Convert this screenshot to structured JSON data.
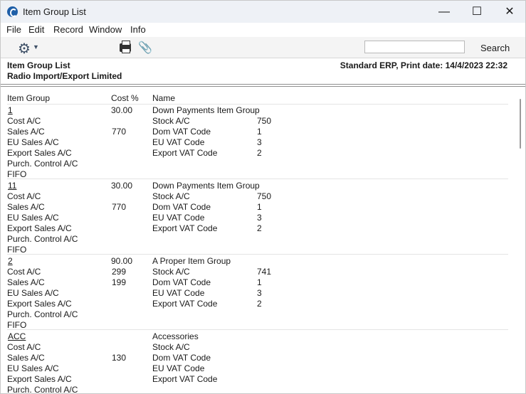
{
  "window": {
    "title": "Item Group List",
    "minimize_icon": "minimize-icon",
    "maximize_icon": "maximize-icon",
    "close_icon": "close-icon"
  },
  "menu": [
    "File",
    "Edit",
    "Record",
    "Window",
    "Info"
  ],
  "toolbar": {
    "search_value": "",
    "search_label": "Search"
  },
  "report": {
    "title": "Item Group List",
    "company": "Radio Import/Export Limited",
    "meta": "Standard ERP, Print date: 14/4/2023 22:32"
  },
  "columns": {
    "group": "Item Group",
    "cost": "Cost %",
    "name": "Name"
  },
  "groups": [
    {
      "code": "1",
      "cost": "30.00",
      "name": "Down Payments Item Group",
      "left": [
        "Cost A/C",
        "Sales A/C",
        "EU Sales A/C",
        "Export Sales A/C",
        "Purch. Control A/C",
        "FIFO"
      ],
      "left_vals": [
        "",
        "770",
        "",
        "",
        "",
        ""
      ],
      "right": [
        "Stock A/C",
        "Dom VAT Code",
        "EU VAT Code",
        "Export VAT Code"
      ],
      "right_vals": [
        "750",
        "1",
        "3",
        "2"
      ]
    },
    {
      "code": "11",
      "cost": "30.00",
      "name": "Down Payments Item Group",
      "left": [
        "Cost A/C",
        "Sales A/C",
        "EU Sales A/C",
        "Export Sales A/C",
        "Purch. Control A/C",
        "FIFO"
      ],
      "left_vals": [
        "",
        "770",
        "",
        "",
        "",
        ""
      ],
      "right": [
        "Stock A/C",
        "Dom VAT Code",
        "EU VAT Code",
        "Export VAT Code"
      ],
      "right_vals": [
        "750",
        "1",
        "3",
        "2"
      ]
    },
    {
      "code": "2",
      "cost": "90.00",
      "name": "A Proper Item Group",
      "left": [
        "Cost A/C",
        "Sales A/C",
        "EU Sales A/C",
        "Export Sales A/C",
        "Purch. Control A/C",
        "FIFO"
      ],
      "left_vals": [
        "299",
        "199",
        "",
        "",
        "",
        ""
      ],
      "right": [
        "Stock A/C",
        "Dom VAT Code",
        "EU VAT Code",
        "Export VAT Code"
      ],
      "right_vals": [
        "741",
        "1",
        "3",
        "2"
      ]
    },
    {
      "code": "ACC",
      "cost": "",
      "name": "Accessories",
      "left": [
        "Cost A/C",
        "Sales A/C",
        "EU Sales A/C",
        "Export Sales A/C",
        "Purch. Control A/C"
      ],
      "left_vals": [
        "",
        "130",
        "",
        "",
        ""
      ],
      "right": [
        "Stock A/C",
        "Dom VAT Code",
        "EU VAT Code",
        "Export VAT Code"
      ],
      "right_vals": [
        "",
        "",
        "",
        ""
      ]
    }
  ]
}
